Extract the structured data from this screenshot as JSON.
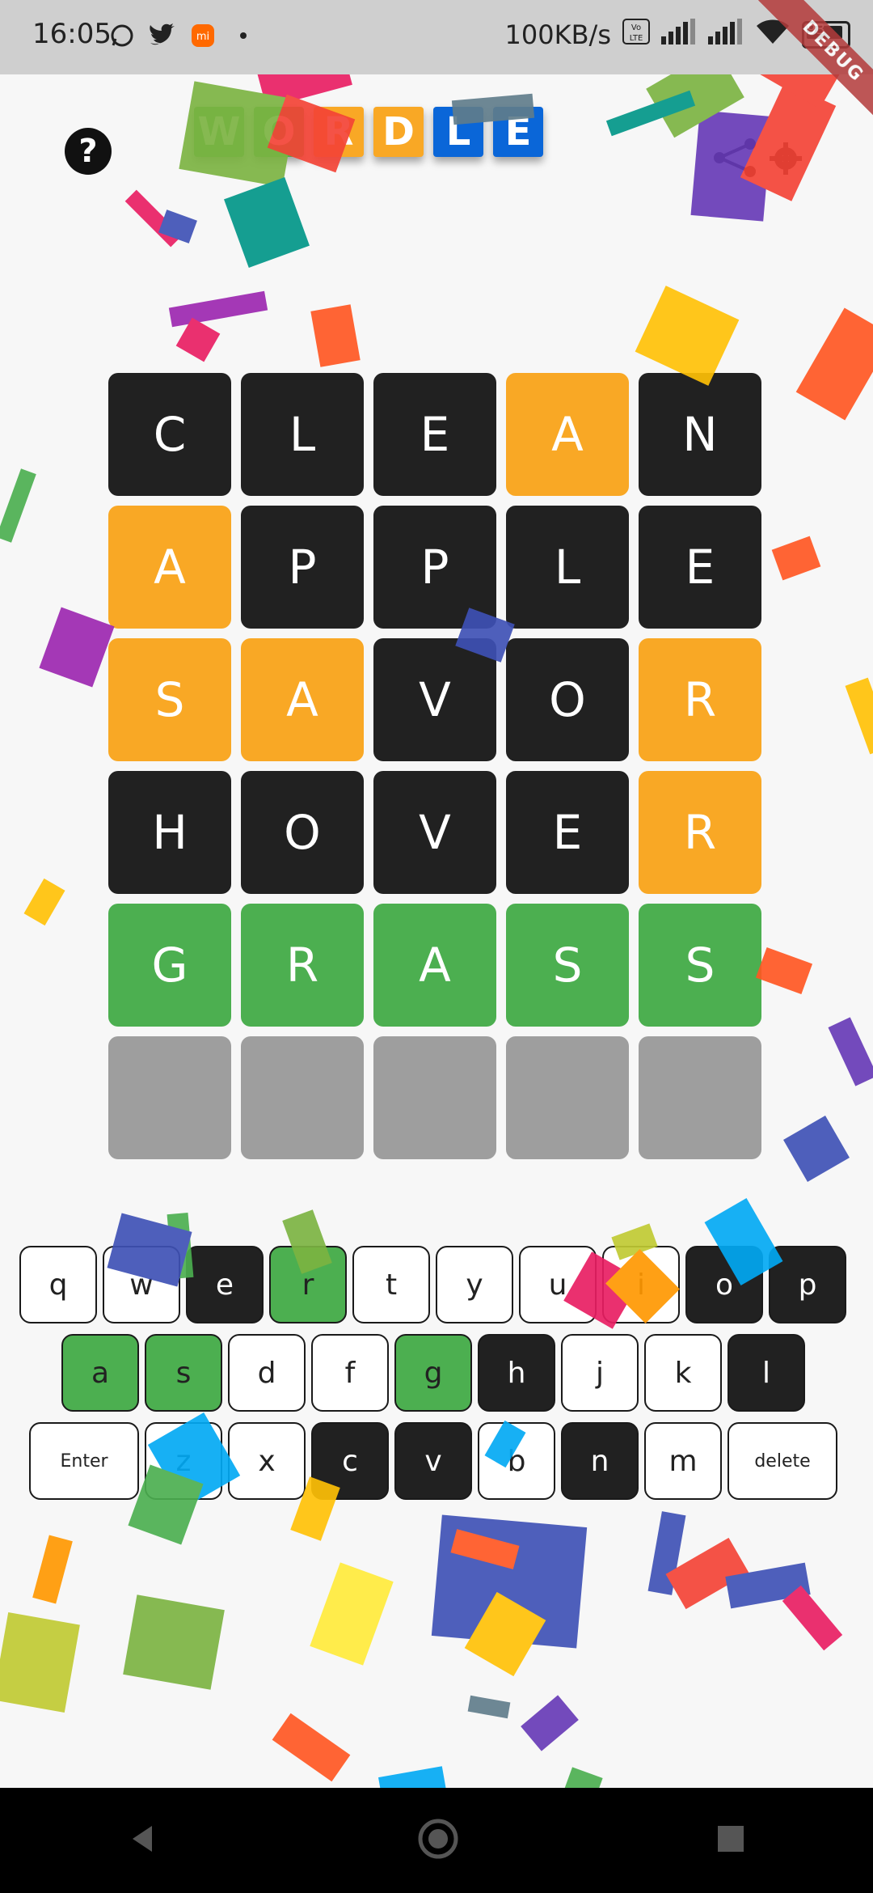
{
  "status_bar": {
    "time": "16:05",
    "network_speed": "100KB/s",
    "battery_level": "93",
    "icons": [
      "whatsapp-icon",
      "twitter-icon",
      "mi-icon",
      "dot-icon",
      "volte-icon",
      "signal-icon",
      "signal-icon",
      "wifi-icon",
      "battery-icon"
    ]
  },
  "debug_banner": "DEBUG",
  "header": {
    "help_label": "?",
    "logo_letters": [
      {
        "letter": "W",
        "color": "#4caf50"
      },
      {
        "letter": "O",
        "color": "#4caf50"
      },
      {
        "letter": "R",
        "color": "#f9a825"
      },
      {
        "letter": "D",
        "color": "#f9a825"
      },
      {
        "letter": "L",
        "color": "#0a66d8"
      },
      {
        "letter": "E",
        "color": "#0a66d8"
      }
    ],
    "share_icon": "share-icon",
    "settings_icon": "settings-icon"
  },
  "board": {
    "rows": [
      [
        {
          "l": "C",
          "s": "absent"
        },
        {
          "l": "L",
          "s": "absent"
        },
        {
          "l": "E",
          "s": "absent"
        },
        {
          "l": "A",
          "s": "present"
        },
        {
          "l": "N",
          "s": "absent"
        }
      ],
      [
        {
          "l": "A",
          "s": "present"
        },
        {
          "l": "P",
          "s": "absent"
        },
        {
          "l": "P",
          "s": "absent"
        },
        {
          "l": "L",
          "s": "absent"
        },
        {
          "l": "E",
          "s": "absent"
        }
      ],
      [
        {
          "l": "S",
          "s": "present"
        },
        {
          "l": "A",
          "s": "present"
        },
        {
          "l": "V",
          "s": "absent"
        },
        {
          "l": "O",
          "s": "absent"
        },
        {
          "l": "R",
          "s": "present"
        }
      ],
      [
        {
          "l": "H",
          "s": "absent"
        },
        {
          "l": "O",
          "s": "absent"
        },
        {
          "l": "V",
          "s": "absent"
        },
        {
          "l": "E",
          "s": "absent"
        },
        {
          "l": "R",
          "s": "present"
        }
      ],
      [
        {
          "l": "G",
          "s": "correct"
        },
        {
          "l": "R",
          "s": "correct"
        },
        {
          "l": "A",
          "s": "correct"
        },
        {
          "l": "S",
          "s": "correct"
        },
        {
          "l": "S",
          "s": "correct"
        }
      ],
      [
        {
          "l": "",
          "s": "empty"
        },
        {
          "l": "",
          "s": "empty"
        },
        {
          "l": "",
          "s": "empty"
        },
        {
          "l": "",
          "s": "empty"
        },
        {
          "l": "",
          "s": "empty"
        }
      ]
    ]
  },
  "keyboard": {
    "row1": [
      {
        "k": "q",
        "s": "unused"
      },
      {
        "k": "w",
        "s": "unused"
      },
      {
        "k": "e",
        "s": "absent"
      },
      {
        "k": "r",
        "s": "correct"
      },
      {
        "k": "t",
        "s": "unused"
      },
      {
        "k": "y",
        "s": "unused"
      },
      {
        "k": "u",
        "s": "unused"
      },
      {
        "k": "i",
        "s": "unused"
      },
      {
        "k": "o",
        "s": "absent"
      },
      {
        "k": "p",
        "s": "absent"
      }
    ],
    "row2": [
      {
        "k": "a",
        "s": "correct"
      },
      {
        "k": "s",
        "s": "correct"
      },
      {
        "k": "d",
        "s": "unused"
      },
      {
        "k": "f",
        "s": "unused"
      },
      {
        "k": "g",
        "s": "correct"
      },
      {
        "k": "h",
        "s": "absent"
      },
      {
        "k": "j",
        "s": "unused"
      },
      {
        "k": "k",
        "s": "unused"
      },
      {
        "k": "l",
        "s": "absent"
      }
    ],
    "row3": [
      {
        "k": "Enter",
        "s": "action"
      },
      {
        "k": "z",
        "s": "unused"
      },
      {
        "k": "x",
        "s": "unused"
      },
      {
        "k": "c",
        "s": "absent"
      },
      {
        "k": "v",
        "s": "absent"
      },
      {
        "k": "b",
        "s": "unused"
      },
      {
        "k": "n",
        "s": "absent"
      },
      {
        "k": "m",
        "s": "unused"
      },
      {
        "k": "delete",
        "s": "action"
      }
    ]
  },
  "colors": {
    "absent": "#212121",
    "present": "#f9a825",
    "correct": "#4caf50",
    "empty": "#9e9e9e"
  },
  "nav_bar": {
    "icons": [
      "back-icon",
      "home-icon",
      "recents-icon"
    ]
  }
}
